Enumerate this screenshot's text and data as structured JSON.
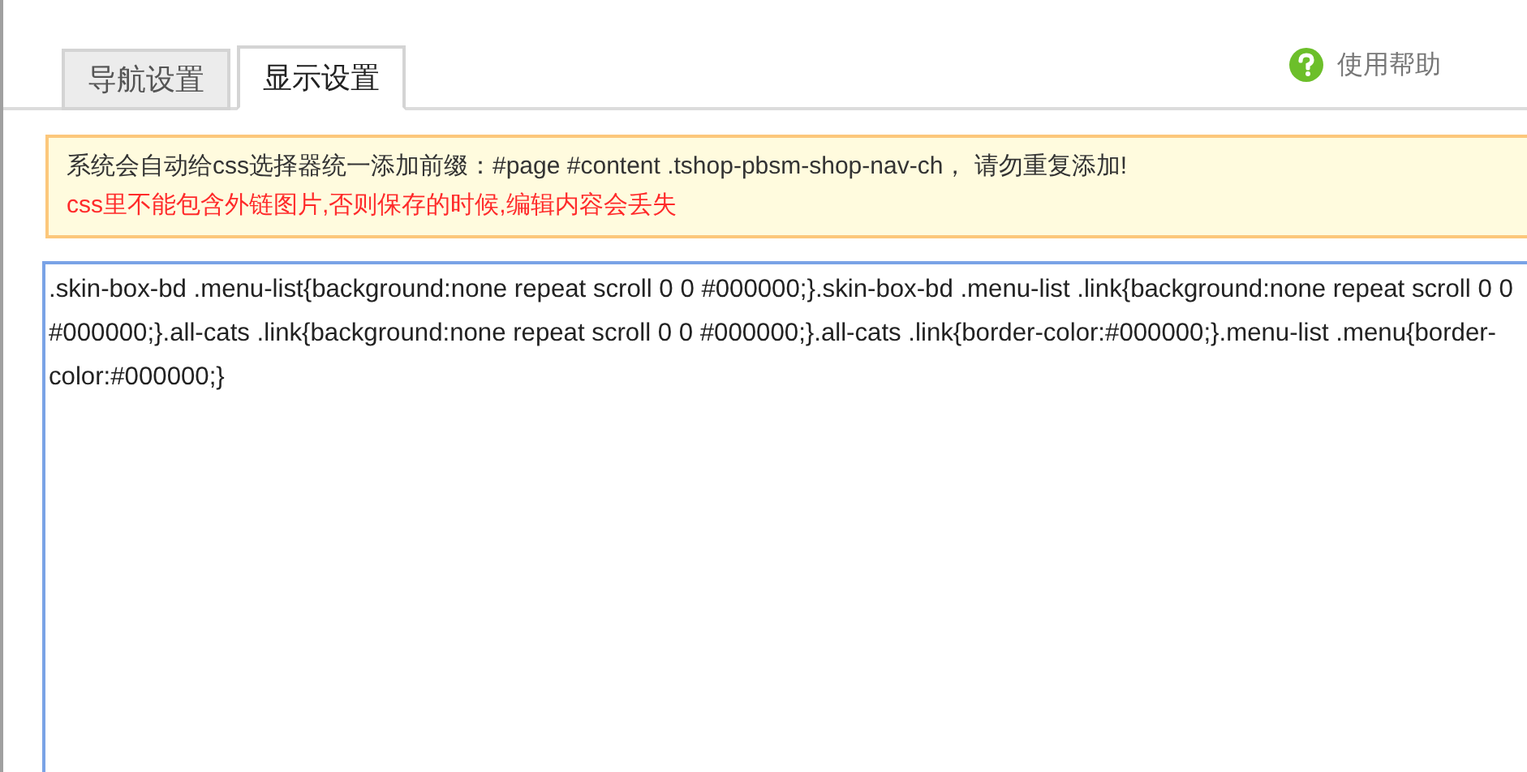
{
  "tabs": [
    {
      "label": "导航设置",
      "selected": false
    },
    {
      "label": "显示设置",
      "selected": true
    }
  ],
  "help": {
    "label": "使用帮助"
  },
  "notice": {
    "lines": [
      {
        "text": "系统会自动给css选择器统一添加前缀：#page #content .tshop-pbsm-shop-nav-ch， 请勿重复添加!",
        "kind": "info"
      },
      {
        "text": "css里不能包含外链图片,否则保存的时候,编辑内容会丢失",
        "kind": "warning"
      }
    ]
  },
  "editor": {
    "value": ".skin-box-bd .menu-list{background:none repeat scroll 0 0 #000000;}.skin-box-bd .menu-list .link{background:none repeat scroll 0 0 #000000;}.all-cats .link{background:none repeat scroll 0 0 #000000;}.all-cats .link{border-color:#000000;}.menu-list .menu{border-color:#000000;}"
  }
}
